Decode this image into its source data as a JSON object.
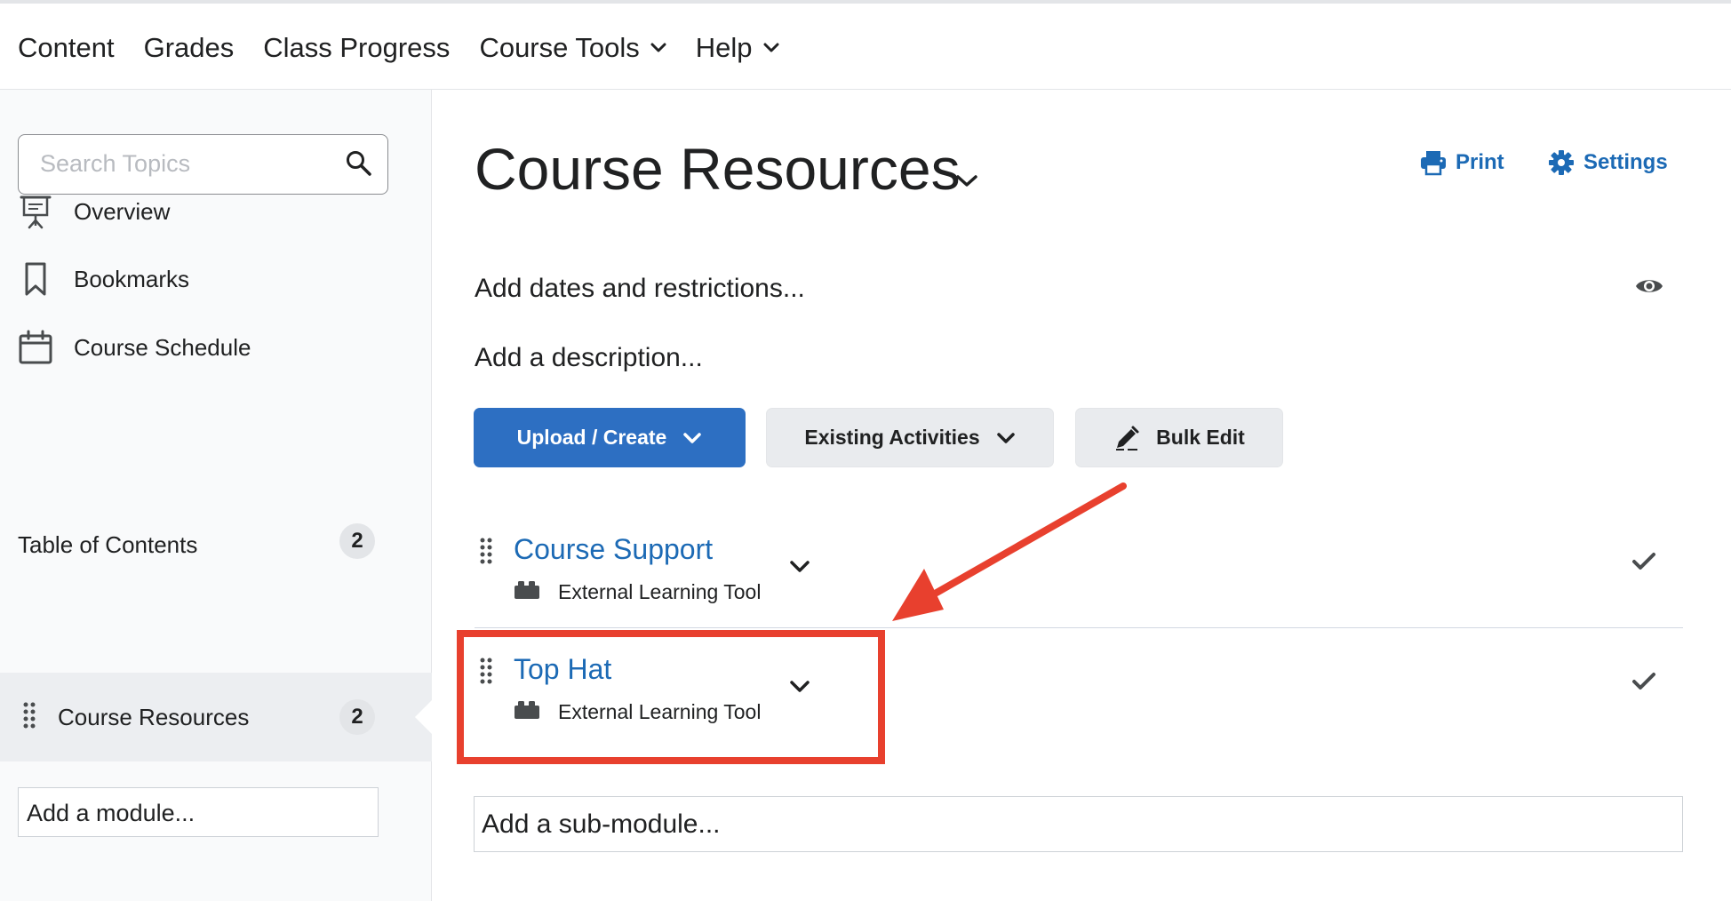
{
  "topnav": {
    "items": [
      {
        "label": "Content",
        "dropdown": false
      },
      {
        "label": "Grades",
        "dropdown": false
      },
      {
        "label": "Class Progress",
        "dropdown": false
      },
      {
        "label": "Course Tools",
        "dropdown": true
      },
      {
        "label": "Help",
        "dropdown": true
      }
    ]
  },
  "sidebar": {
    "search_placeholder": "Search Topics",
    "links": [
      {
        "label": "Overview",
        "icon": "presentation-icon"
      },
      {
        "label": "Bookmarks",
        "icon": "bookmark-icon"
      },
      {
        "label": "Course Schedule",
        "icon": "calendar-icon"
      }
    ],
    "toc": {
      "label": "Table of Contents",
      "count": "2"
    },
    "module": {
      "label": "Course Resources",
      "count": "2"
    },
    "add_module_label": "Add a module..."
  },
  "main": {
    "title": "Course Resources",
    "print_label": "Print",
    "settings_label": "Settings",
    "add_dates_label": "Add dates and restrictions...",
    "add_description_label": "Add a description...",
    "buttons": {
      "upload_create": "Upload / Create",
      "existing_activities": "Existing Activities",
      "bulk_edit": "Bulk Edit"
    },
    "topics": [
      {
        "title": "Course Support",
        "type": "External Learning Tool",
        "completed": true
      },
      {
        "title": "Top Hat",
        "type": "External Learning Tool",
        "completed": true
      }
    ],
    "add_submodule_label": "Add a sub-module..."
  },
  "colors": {
    "accent": "#2d6fc2",
    "link": "#1c6ab5",
    "annotation": "#e8402e"
  }
}
